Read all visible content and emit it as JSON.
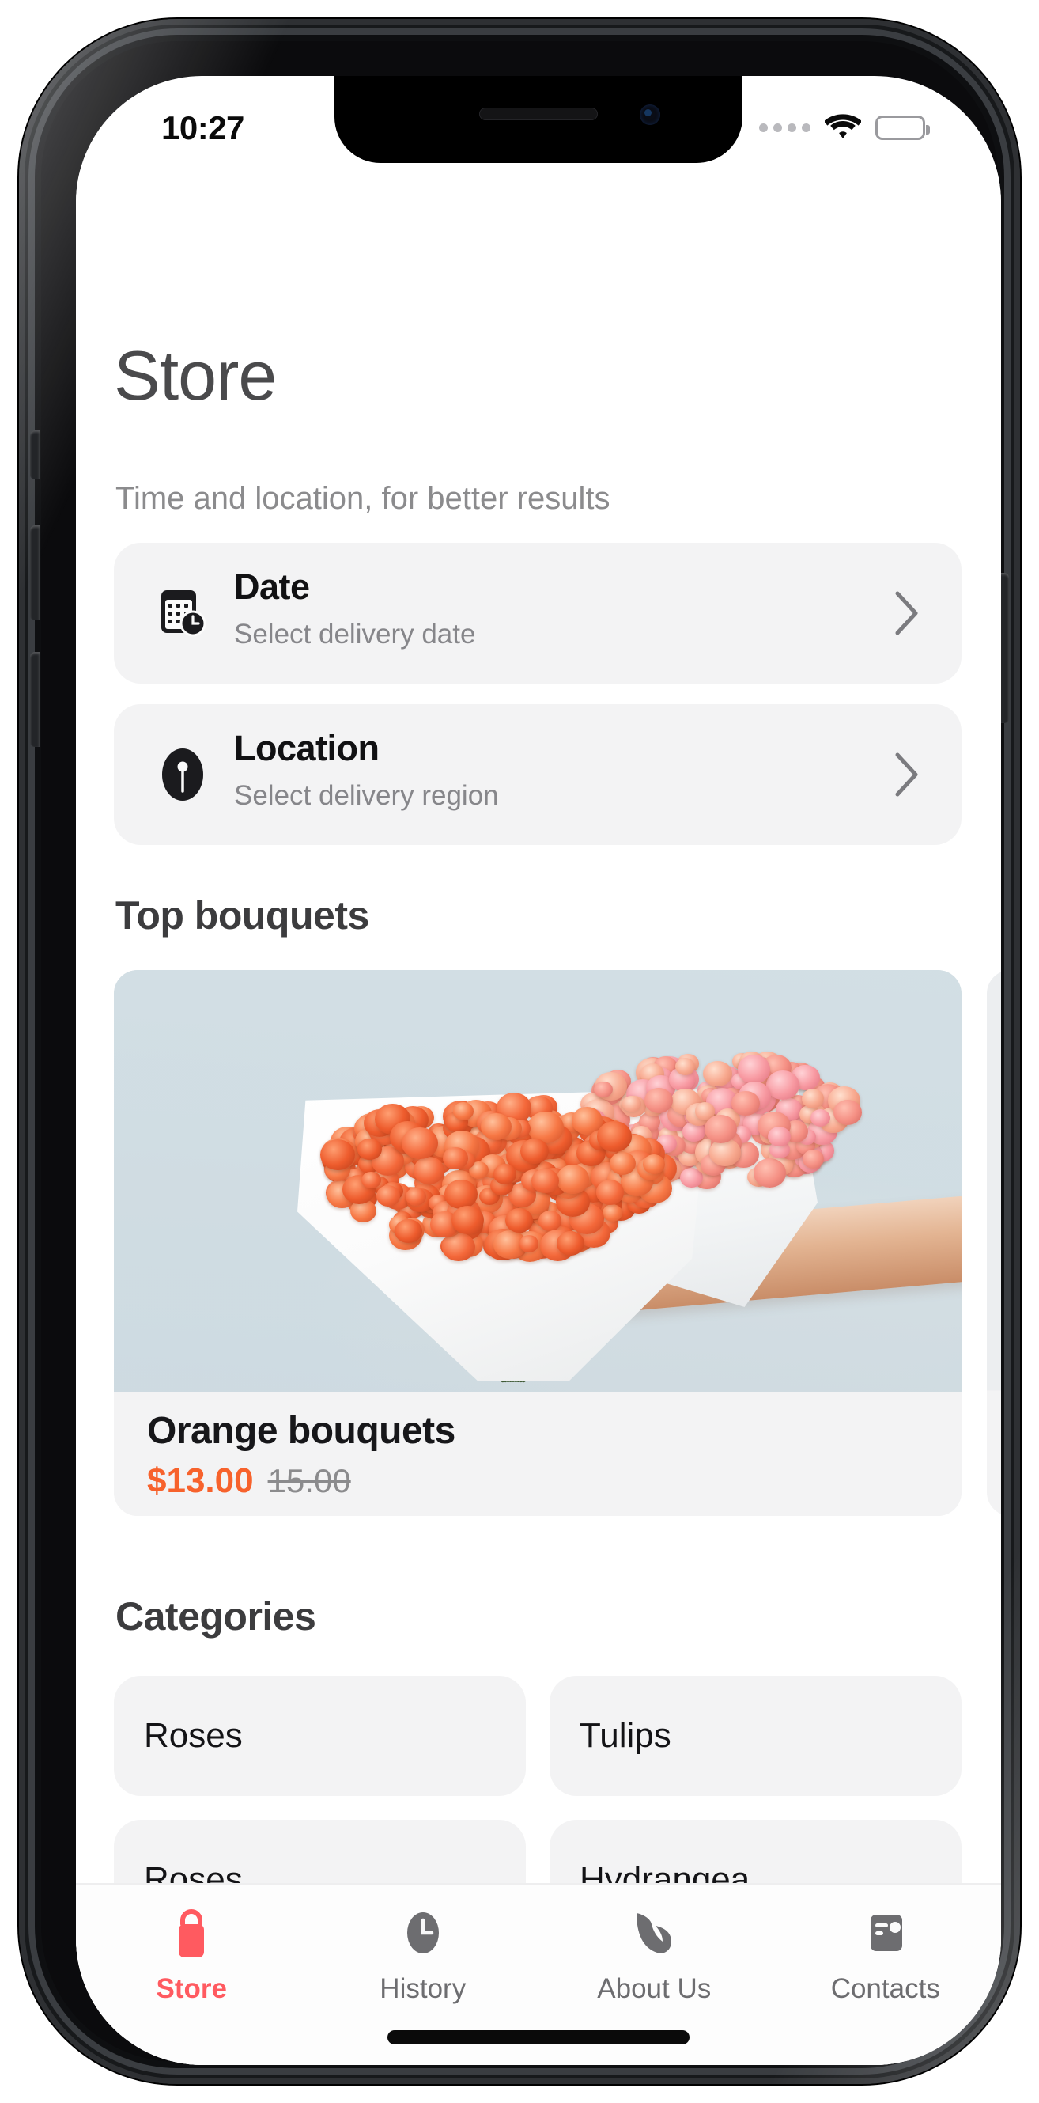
{
  "status_bar": {
    "time": "10:27",
    "signal_icon": "signal-dots-icon",
    "wifi_icon": "wifi-icon",
    "battery_icon": "battery-full-icon"
  },
  "header": {
    "title": "Store",
    "subtitle": "Time and location, for better results"
  },
  "options": [
    {
      "id": "date",
      "icon": "calendar-clock-icon",
      "title": "Date",
      "subtitle": "Select delivery date",
      "chevron": "chevron-right-icon"
    },
    {
      "id": "location",
      "icon": "location-pin-icon",
      "title": "Location",
      "subtitle": "Select delivery region",
      "chevron": "chevron-right-icon"
    }
  ],
  "top_bouquets": {
    "heading": "Top bouquets",
    "products": [
      {
        "name": "Orange bouquets",
        "price": "$13.00",
        "old_price": "15.00",
        "image_alt": "orange-chrysanthemum-bouquet-photo"
      }
    ]
  },
  "categories": {
    "heading": "Categories",
    "items": [
      {
        "label": "Roses"
      },
      {
        "label": "Tulips"
      },
      {
        "label": "Roses"
      },
      {
        "label": "Hydrangea"
      }
    ]
  },
  "tab_bar": {
    "items": [
      {
        "id": "store",
        "label": "Store",
        "icon": "shopping-bag-icon",
        "active": true
      },
      {
        "id": "history",
        "label": "History",
        "icon": "clock-icon",
        "active": false
      },
      {
        "id": "about-us",
        "label": "About Us",
        "icon": "leaf-icon",
        "active": false
      },
      {
        "id": "contacts",
        "label": "Contacts",
        "icon": "contact-card-icon",
        "active": false
      }
    ]
  },
  "colors": {
    "accent_red": "#ff5a60",
    "price_orange": "#f7622c",
    "card_gray": "#f3f3f4",
    "muted_text": "#86868a",
    "title_text": "#3c3c3e"
  }
}
